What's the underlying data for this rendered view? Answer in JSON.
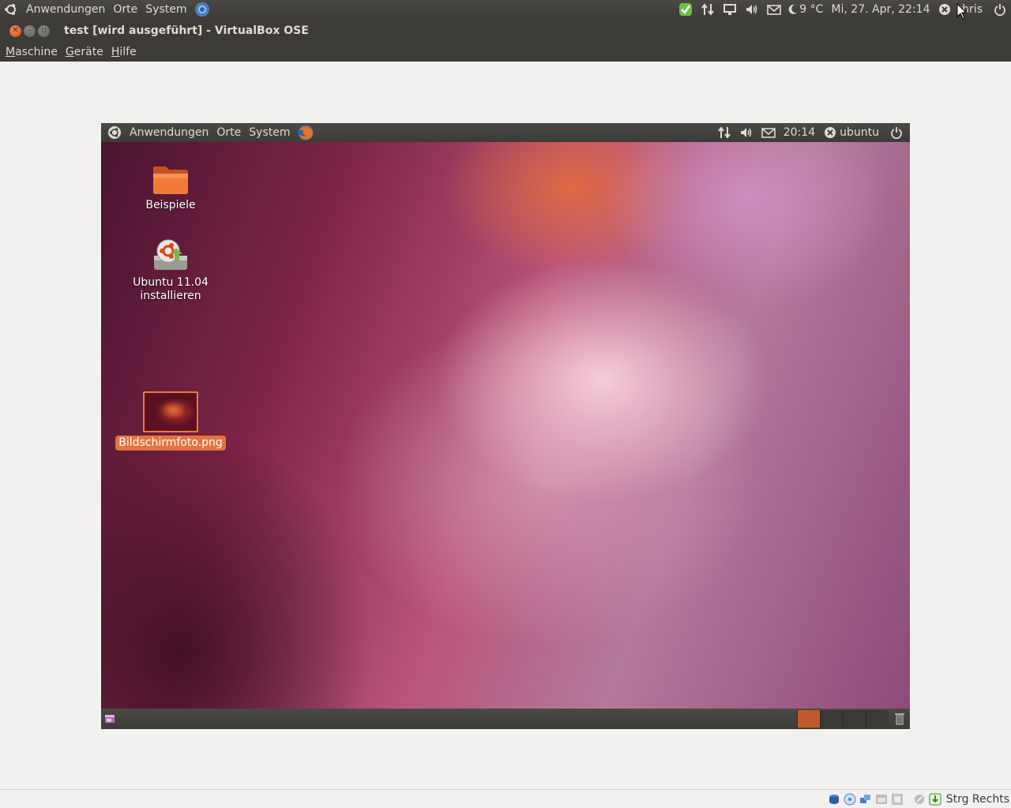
{
  "host_panel": {
    "menus": [
      "Anwendungen",
      "Orte",
      "System"
    ],
    "weather": "9 °C",
    "datetime": "Mi, 27. Apr, 22:14",
    "user": "chris"
  },
  "window": {
    "title": "test [wird ausgeführt] - VirtualBox OSE",
    "menus": [
      "Maschine",
      "Geräte",
      "Hilfe"
    ]
  },
  "guest": {
    "panel_menus": [
      "Anwendungen",
      "Orte",
      "System"
    ],
    "clock": "20:14",
    "user": "ubuntu",
    "desktop_icons": [
      {
        "label": "Beispiele",
        "icon": "folder-icon"
      },
      {
        "label_line1": "Ubuntu 11.04",
        "label_line2": "installieren",
        "icon": "installer-icon"
      },
      {
        "label": "Bildschirmfoto.png",
        "icon": "image-thumbnail-icon",
        "selected": true
      }
    ],
    "workspaces": 4,
    "active_workspace": 1
  },
  "statusbar": {
    "host_key": "Strg Rechts"
  },
  "colors": {
    "panel": "#3c3b37",
    "accent": "#dd4814",
    "selection": "#e5733f"
  }
}
